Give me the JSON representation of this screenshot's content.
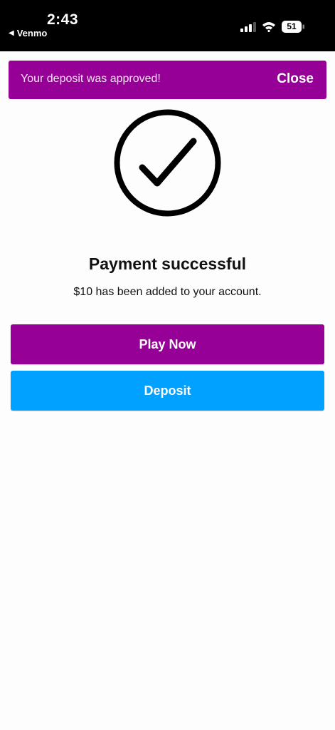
{
  "status_bar": {
    "time": "2:43",
    "back_app": "Venmo",
    "battery": "51"
  },
  "banner": {
    "message": "Your deposit was approved!",
    "close_label": "Close"
  },
  "content": {
    "title": "Payment successful",
    "subtitle": "$10 has been added to your account."
  },
  "buttons": {
    "play_now": "Play Now",
    "deposit": "Deposit"
  },
  "colors": {
    "brand_purple": "#970096",
    "deposit_blue": "#00a1ff"
  },
  "icons": {
    "success": "checkmark-circle-icon"
  }
}
